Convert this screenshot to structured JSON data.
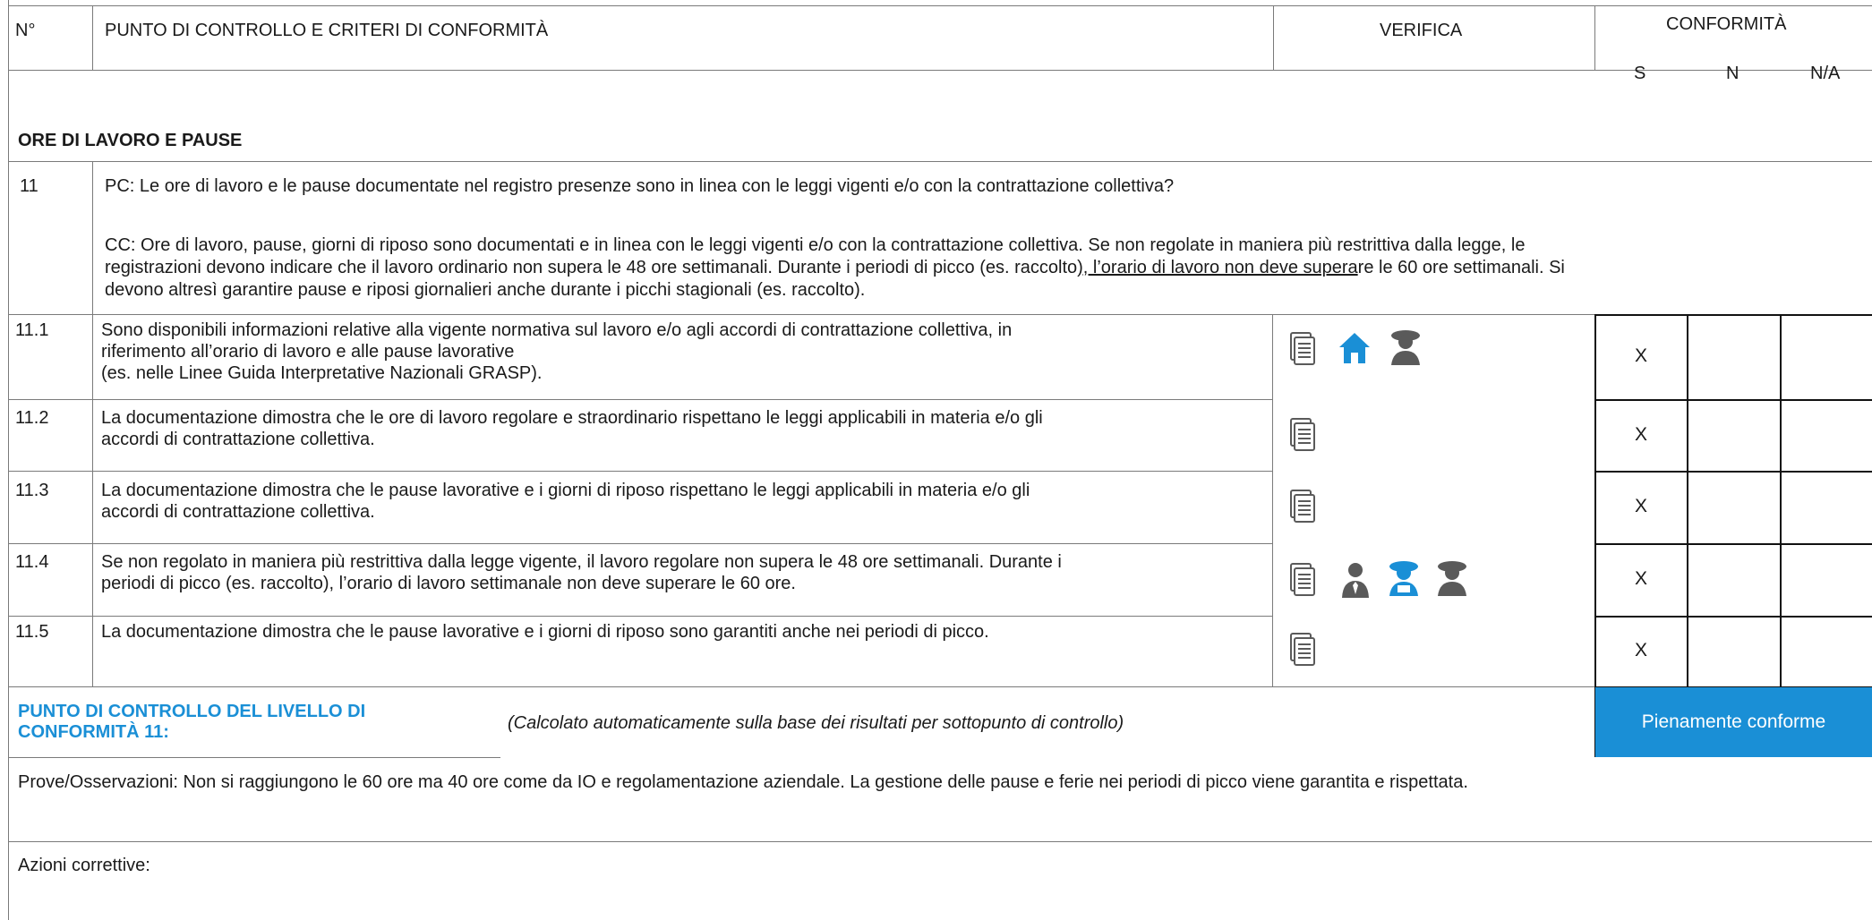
{
  "header": {
    "num": "N°",
    "criteria": "PUNTO DI CONTROLLO E CRITERI DI CONFORMITÀ",
    "verifica": "VERIFICA",
    "conformita": "CONFORMITÀ",
    "s": "S",
    "n": "N",
    "na": "N/A"
  },
  "section": {
    "title": "ORE DI LAVORO E PAUSE"
  },
  "control": {
    "num": "11",
    "pc": "PC: Le ore di lavoro e le pause documentate nel registro presenze sono in linea con le leggi vigenti e/o con la contrattazione collettiva?",
    "cc_line1": "CC: Ore di lavoro, pause, giorni di riposo sono documentati e in linea con le leggi vigenti e/o con la contrattazione collettiva. Se non regolate in maniera più restrittiva dalla legge, le",
    "cc_line2_a": "registrazioni devono indicare che il lavoro ordinario non supera le 48 ore settimanali. Durante i periodi di picco (es. raccolto",
    "cc_line2_b": "), l’orario di lavoro non deve supera",
    "cc_line2_c": "re le 60 ore settimanali. Si",
    "cc_line3": "devono altresì garantire pause e riposi giornalieri anche durante i picchi stagionali (es. raccolto)."
  },
  "items": [
    {
      "num": "11.1",
      "lines": [
        "Sono disponibili informazioni relative alla vigente normativa sul lavoro e/o agli accordi di contrattazione collettiva, in",
        "riferimento all’orario di lavoro e alle pause lavorative",
        "(es. nelle Linee Guida Interpretative Nazionali GRASP)."
      ],
      "icons": [
        "document-icon",
        "house-icon",
        "worker-hat-icon"
      ],
      "s": "X",
      "n": "",
      "na": ""
    },
    {
      "num": "11.2",
      "lines": [
        "La documentazione dimostra che le ore di lavoro regolare e straordinario rispettano le leggi applicabili in materia e/o gli",
        "accordi di contrattazione collettiva."
      ],
      "icons": [
        "document-icon"
      ],
      "s": "X",
      "n": "",
      "na": ""
    },
    {
      "num": "11.3",
      "lines": [
        "La documentazione dimostra che le pause lavorative e i giorni di riposo rispettano le leggi applicabili in materia e/o gli",
        "accordi di contrattazione collettiva."
      ],
      "icons": [
        "document-icon"
      ],
      "s": "X",
      "n": "",
      "na": ""
    },
    {
      "num": "11.4",
      "lines": [
        "Se non regolato in maniera più restrittiva dalla legge vigente, il lavoro regolare non supera le 48 ore settimanali. Durante i",
        "periodi di picco (es. raccolto), l’orario di lavoro settimanale non deve superare le 60 ore."
      ],
      "icons": [
        "document-icon",
        "manager-icon",
        "worker-blue-icon",
        "worker-hat-icon"
      ],
      "s": "X",
      "n": "",
      "na": ""
    },
    {
      "num": "11.5",
      "lines": [
        "La documentazione dimostra che le pause lavorative e i giorni di riposo sono garantiti anche nei periodi di picco."
      ],
      "icons": [
        "document-icon"
      ],
      "s": "X",
      "n": "",
      "na": ""
    }
  ],
  "summary": {
    "label_line1": "PUNTO DI CONTROLLO DEL LIVELLO DI",
    "label_line2": "CONFORMITÀ 11:",
    "note": "(Calcolato automaticamente sulla base dei risultati per sottopunto di controllo)",
    "result": "Pienamente conforme"
  },
  "observations": "Prove/Osservazioni: Non si raggiungono le 60 ore ma 40 ore come da IO e regolamentazione aziendale. La gestione delle pause e ferie nei periodi di picco viene garantita e rispettata.",
  "corrective": "Azioni correttive:",
  "colors": {
    "accent": "#1a8fd6",
    "icon_gray": "#5a5a5a",
    "text": "#1a1a1a"
  }
}
